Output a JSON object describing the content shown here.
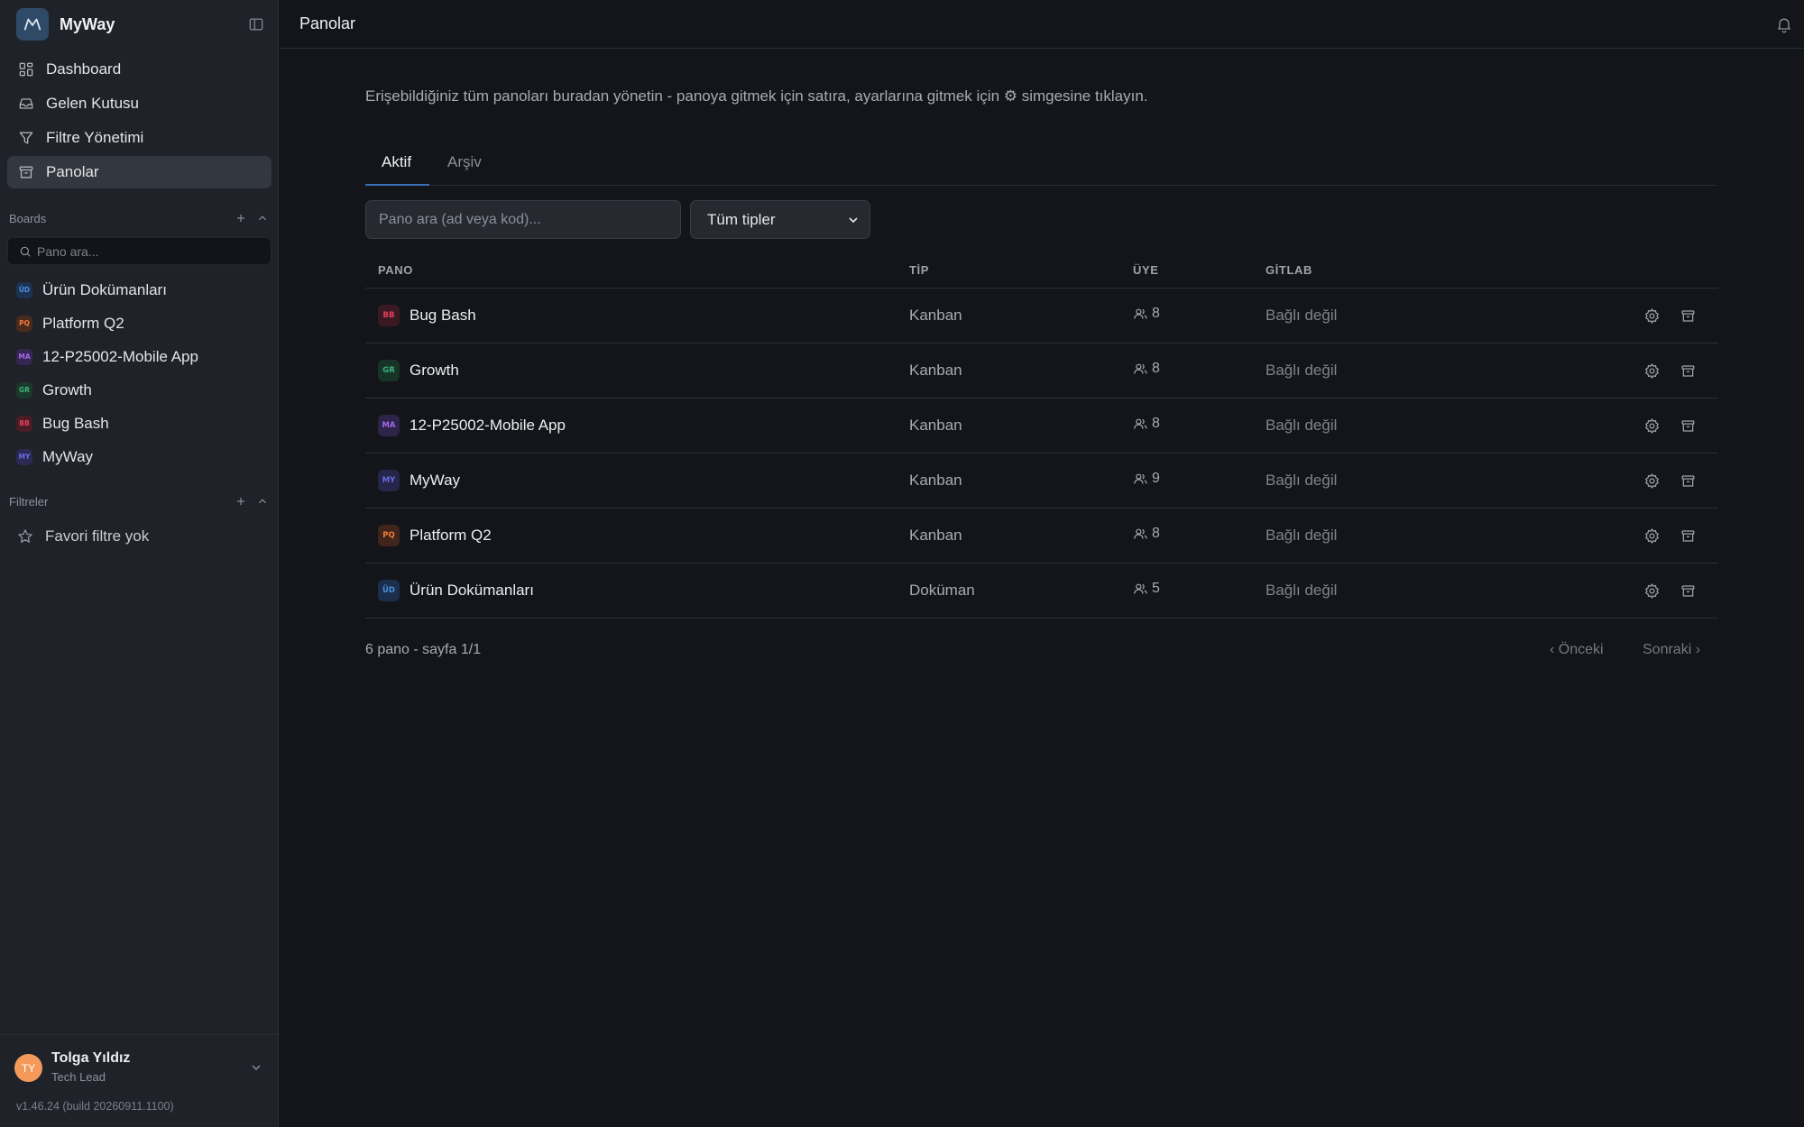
{
  "app": {
    "name": "MyWay"
  },
  "sidebar": {
    "nav": [
      {
        "label": "Dashboard",
        "icon": "dashboard-icon",
        "active": false
      },
      {
        "label": "Gelen Kutusu",
        "icon": "inbox-icon",
        "active": false
      },
      {
        "label": "Filtre Yönetimi",
        "icon": "filter-icon",
        "active": false
      },
      {
        "label": "Panolar",
        "icon": "archive-box-icon",
        "active": true
      }
    ],
    "boards_header": "Boards",
    "search_placeholder": "Pano ara...",
    "boards": [
      {
        "code": "ÜD",
        "name": "Ürün Dokümanları",
        "color": "#4a8fe0",
        "bg": "#1d3352"
      },
      {
        "code": "PQ",
        "name": "Platform Q2",
        "color": "#f07a3a",
        "bg": "#4a2a1c"
      },
      {
        "code": "MA",
        "name": "12-P25002-Mobile App",
        "color": "#a06ae8",
        "bg": "#352652"
      },
      {
        "code": "GR",
        "name": "Growth",
        "color": "#3cb07a",
        "bg": "#1b3a2d"
      },
      {
        "code": "BB",
        "name": "Bug Bash",
        "color": "#e0405a",
        "bg": "#4a1d26"
      },
      {
        "code": "MY",
        "name": "MyWay",
        "color": "#6a6ae8",
        "bg": "#2a2a52"
      }
    ],
    "filters_header": "Filtreler",
    "filters_empty": "Favori filtre yok",
    "user": {
      "initials": "TY",
      "name": "Tolga Yıldız",
      "role": "Tech Lead"
    },
    "version": "v1.46.24 (build 20260911.1100)"
  },
  "topbar": {
    "title": "Panolar"
  },
  "main": {
    "description": "Erişebildiğiniz tüm panoları buradan yönetin - panoya gitmek için satıra, ayarlarına gitmek için ⚙ simgesine tıklayın.",
    "tabs": [
      {
        "label": "Aktif",
        "active": true
      },
      {
        "label": "Arşiv",
        "active": false
      }
    ],
    "search_placeholder": "Pano ara (ad veya kod)...",
    "type_filter": "Tüm tipler",
    "columns": {
      "board": "PANO",
      "type": "TİP",
      "members": "ÜYE",
      "gitlab": "GİTLAB"
    },
    "rows": [
      {
        "code": "BB",
        "name": "Bug Bash",
        "type": "Kanban",
        "members": "8",
        "gitlab": "Bağlı değil",
        "color": "#e0405a",
        "bg": "#3a1a22"
      },
      {
        "code": "GR",
        "name": "Growth",
        "type": "Kanban",
        "members": "8",
        "gitlab": "Bağlı değil",
        "color": "#3cb07a",
        "bg": "#183429"
      },
      {
        "code": "MA",
        "name": "12-P25002-Mobile App",
        "type": "Kanban",
        "members": "8",
        "gitlab": "Bağlı değil",
        "color": "#a06ae8",
        "bg": "#2e2348"
      },
      {
        "code": "MY",
        "name": "MyWay",
        "type": "Kanban",
        "members": "9",
        "gitlab": "Bağlı değil",
        "color": "#6a6ae8",
        "bg": "#26264a"
      },
      {
        "code": "PQ",
        "name": "Platform Q2",
        "type": "Kanban",
        "members": "8",
        "gitlab": "Bağlı değil",
        "color": "#f07a3a",
        "bg": "#40261a"
      },
      {
        "code": "ÜD",
        "name": "Ürün Dokümanları",
        "type": "Doküman",
        "members": "5",
        "gitlab": "Bağlı değil",
        "color": "#4a8fe0",
        "bg": "#1b2f4c"
      }
    ],
    "pagination": {
      "info": "6 pano - sayfa 1/1",
      "prev": "‹ Önceki",
      "next": "Sonraki ›"
    }
  }
}
